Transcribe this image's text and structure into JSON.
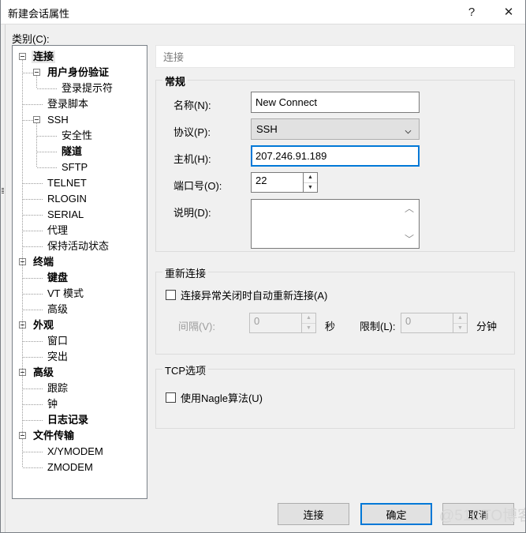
{
  "window": {
    "title": "新建会话属性",
    "help_icon": "?",
    "close_icon": "✕"
  },
  "category": {
    "label": "类别(C):",
    "tree": [
      {
        "label": "连接",
        "level": 0,
        "bold": true,
        "selected": true,
        "expander": true
      },
      {
        "label": "用户身份验证",
        "level": 1,
        "bold": true,
        "selected": false,
        "expander": true
      },
      {
        "label": "登录提示符",
        "level": 2,
        "bold": false,
        "selected": false,
        "expander": false
      },
      {
        "label": "登录脚本",
        "level": 1,
        "bold": false,
        "selected": false,
        "expander": false
      },
      {
        "label": "SSH",
        "level": 1,
        "bold": false,
        "selected": false,
        "expander": true
      },
      {
        "label": "安全性",
        "level": 2,
        "bold": false,
        "selected": false,
        "expander": false
      },
      {
        "label": "隧道",
        "level": 2,
        "bold": true,
        "selected": false,
        "expander": false
      },
      {
        "label": "SFTP",
        "level": 2,
        "bold": false,
        "selected": false,
        "expander": false
      },
      {
        "label": "TELNET",
        "level": 1,
        "bold": false,
        "selected": false,
        "expander": false
      },
      {
        "label": "RLOGIN",
        "level": 1,
        "bold": false,
        "selected": false,
        "expander": false
      },
      {
        "label": "SERIAL",
        "level": 1,
        "bold": false,
        "selected": false,
        "expander": false
      },
      {
        "label": "代理",
        "level": 1,
        "bold": false,
        "selected": false,
        "expander": false
      },
      {
        "label": "保持活动状态",
        "level": 1,
        "bold": false,
        "selected": false,
        "expander": false
      },
      {
        "label": "终端",
        "level": 0,
        "bold": true,
        "selected": false,
        "expander": true
      },
      {
        "label": "键盘",
        "level": 1,
        "bold": true,
        "selected": false,
        "expander": false
      },
      {
        "label": "VT 模式",
        "level": 1,
        "bold": false,
        "selected": false,
        "expander": false
      },
      {
        "label": "高级",
        "level": 1,
        "bold": false,
        "selected": false,
        "expander": false
      },
      {
        "label": "外观",
        "level": 0,
        "bold": true,
        "selected": false,
        "expander": true
      },
      {
        "label": "窗口",
        "level": 1,
        "bold": false,
        "selected": false,
        "expander": false
      },
      {
        "label": "突出",
        "level": 1,
        "bold": false,
        "selected": false,
        "expander": false
      },
      {
        "label": "高级",
        "level": 0,
        "bold": true,
        "selected": false,
        "expander": true
      },
      {
        "label": "跟踪",
        "level": 1,
        "bold": false,
        "selected": false,
        "expander": false
      },
      {
        "label": "钟",
        "level": 1,
        "bold": false,
        "selected": false,
        "expander": false
      },
      {
        "label": "日志记录",
        "level": 1,
        "bold": true,
        "selected": false,
        "expander": false
      },
      {
        "label": "文件传输",
        "level": 0,
        "bold": true,
        "selected": false,
        "expander": true
      },
      {
        "label": "X/YMODEM",
        "level": 1,
        "bold": false,
        "selected": false,
        "expander": false
      },
      {
        "label": "ZMODEM",
        "level": 1,
        "bold": false,
        "selected": false,
        "expander": false
      }
    ]
  },
  "pane": {
    "header": "连接",
    "general": {
      "title": "常规",
      "name_label": "名称(N):",
      "name_value": "New Connect",
      "protocol_label": "协议(P):",
      "protocol_value": "SSH",
      "host_label": "主机(H):",
      "host_value": "207.246.91.189",
      "port_label": "端口号(O):",
      "port_value": "22",
      "desc_label": "说明(D):",
      "desc_value": "",
      "icon": "network-computers-icon"
    },
    "reconnect": {
      "title": "重新连接",
      "auto_label": "连接异常关闭时自动重新连接(A)",
      "auto_checked": false,
      "interval_label": "间隔(V):",
      "interval_value": "0",
      "interval_unit": "秒",
      "limit_label": "限制(L):",
      "limit_value": "0",
      "limit_unit": "分钟"
    },
    "tcp": {
      "title": "TCP选项",
      "nagle_label": "使用Nagle算法(U)",
      "nagle_checked": false
    }
  },
  "footer": {
    "connect_label": "连接",
    "ok_label": "确定",
    "cancel_label": "取消",
    "watermark": "@51CTO博客"
  },
  "colors": {
    "accent": "#0078d7",
    "window_bg": "#f0f0f0",
    "field_bg": "#ffffff",
    "disabled_text": "#9d9d9d"
  }
}
